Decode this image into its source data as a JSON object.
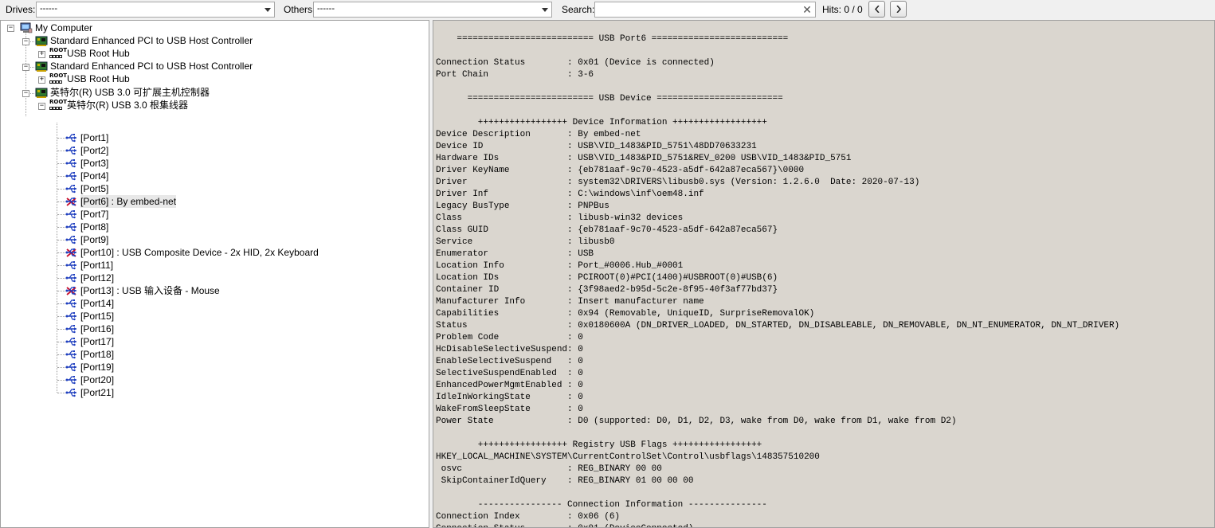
{
  "toolbar": {
    "drives_label": "Drives:",
    "drives_value": "------",
    "others_label": "Others:",
    "others_value": "------",
    "search_label": "Search:",
    "search_value": "",
    "hits_label": "Hits:  0 / 0",
    "prev_icon": "chevron-left-icon",
    "next_icon": "chevron-right-icon"
  },
  "tree": {
    "root": "My Computer",
    "controllers": [
      {
        "label": "Standard Enhanced PCI to USB Host Controller",
        "hub": "USB Root Hub"
      },
      {
        "label": "Standard Enhanced PCI to USB Host Controller",
        "hub": "USB Root Hub"
      },
      {
        "label": "英特尔(R) USB 3.0 可扩展主机控制器",
        "hub": "英特尔(R) USB 3.0 根集线器"
      }
    ],
    "root_badge": "ROOT",
    "ports": [
      {
        "label": "[Port1]",
        "device": false
      },
      {
        "label": "[Port2]",
        "device": false
      },
      {
        "label": "[Port3]",
        "device": false
      },
      {
        "label": "[Port4]",
        "device": false
      },
      {
        "label": "[Port5]",
        "device": false
      },
      {
        "label": "[Port6] : By embed-net",
        "device": true
      },
      {
        "label": "[Port7]",
        "device": false
      },
      {
        "label": "[Port8]",
        "device": false
      },
      {
        "label": "[Port9]",
        "device": false
      },
      {
        "label": "[Port10] : USB Composite Device - 2x HID, 2x Keyboard",
        "device": true
      },
      {
        "label": "[Port11]",
        "device": false
      },
      {
        "label": "[Port12]",
        "device": false
      },
      {
        "label": "[Port13] : USB 输入设备 - Mouse",
        "device": true
      },
      {
        "label": "[Port14]",
        "device": false
      },
      {
        "label": "[Port15]",
        "device": false
      },
      {
        "label": "[Port16]",
        "device": false
      },
      {
        "label": "[Port17]",
        "device": false
      },
      {
        "label": "[Port18]",
        "device": false
      },
      {
        "label": "[Port19]",
        "device": false
      },
      {
        "label": "[Port20]",
        "device": false
      },
      {
        "label": "[Port21]",
        "device": false
      }
    ]
  },
  "detail": {
    "lines": [
      "",
      "    ========================== USB Port6 ==========================",
      "",
      "Connection Status        : 0x01 (Device is connected)",
      "Port Chain               : 3-6",
      "",
      "      ======================== USB Device ========================",
      "",
      "        +++++++++++++++++ Device Information ++++++++++++++++++",
      "Device Description       : By embed-net",
      "Device ID                : USB\\VID_1483&PID_5751\\48DD70633231",
      "Hardware IDs             : USB\\VID_1483&PID_5751&REV_0200 USB\\VID_1483&PID_5751",
      "Driver KeyName           : {eb781aaf-9c70-4523-a5df-642a87eca567}\\0000",
      "Driver                   : system32\\DRIVERS\\libusb0.sys (Version: 1.2.6.0  Date: 2020-07-13)",
      "Driver Inf               : C:\\windows\\inf\\oem48.inf",
      "Legacy BusType           : PNPBus",
      "Class                    : libusb-win32 devices",
      "Class GUID               : {eb781aaf-9c70-4523-a5df-642a87eca567}",
      "Service                  : libusb0",
      "Enumerator               : USB",
      "Location Info            : Port_#0006.Hub_#0001",
      "Location IDs             : PCIROOT(0)#PCI(1400)#USBROOT(0)#USB(6)",
      "Container ID             : {3f98aed2-b95d-5c2e-8f95-40f3af77bd37}",
      "Manufacturer Info        : Insert manufacturer name",
      "Capabilities             : 0x94 (Removable, UniqueID, SurpriseRemovalOK)",
      "Status                   : 0x0180600A (DN_DRIVER_LOADED, DN_STARTED, DN_DISABLEABLE, DN_REMOVABLE, DN_NT_ENUMERATOR, DN_NT_DRIVER)",
      "Problem Code             : 0",
      "HcDisableSelectiveSuspend: 0",
      "EnableSelectiveSuspend   : 0",
      "SelectiveSuspendEnabled  : 0",
      "EnhancedPowerMgmtEnabled : 0",
      "IdleInWorkingState       : 0",
      "WakeFromSleepState       : 0",
      "Power State              : D0 (supported: D0, D1, D2, D3, wake from D0, wake from D1, wake from D2)",
      "",
      "        +++++++++++++++++ Registry USB Flags +++++++++++++++++",
      "HKEY_LOCAL_MACHINE\\SYSTEM\\CurrentControlSet\\Control\\usbflags\\148357510200",
      " osvc                    : REG_BINARY 00 00",
      " SkipContainerIdQuery    : REG_BINARY 01 00 00 00",
      "",
      "        ---------------- Connection Information ---------------",
      "Connection Index         : 0x06 (6)",
      "Connection Status        : 0x01 (DeviceConnected)"
    ]
  },
  "colors": {
    "detail_bg": "#dad6cf",
    "tree_bg": "#ffffff",
    "toolbar_bg": "#f0f0f0",
    "usb_blue": "#1f3fbf",
    "device_red": "#c8102e"
  }
}
